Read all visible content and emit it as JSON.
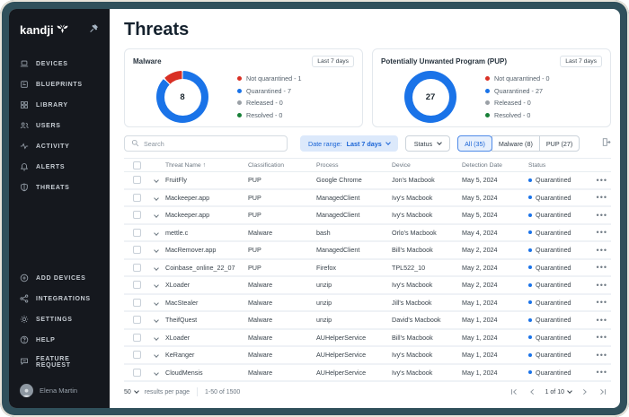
{
  "colors": {
    "accent_blue": "#1a73e8",
    "alert_red": "#d93025",
    "neutral_gray": "#9aa0a6",
    "success_green": "#188038",
    "sidebar_bg": "#15181e",
    "frame_border": "#30505b"
  },
  "sidebar": {
    "logo_text": "kandji",
    "nav": [
      {
        "icon": "devices-icon",
        "label": "DEVICES"
      },
      {
        "icon": "blueprints-icon",
        "label": "BLUEPRINTS"
      },
      {
        "icon": "library-icon",
        "label": "LIBRARY"
      },
      {
        "icon": "users-icon",
        "label": "USERS"
      },
      {
        "icon": "activity-icon",
        "label": "ACTIVITY"
      },
      {
        "icon": "alerts-icon",
        "label": "ALERTS"
      },
      {
        "icon": "threats-icon",
        "label": "THREATS"
      }
    ],
    "secondary_nav": [
      {
        "icon": "add-circle-icon",
        "label": "ADD DEVICES"
      },
      {
        "icon": "integrations-icon",
        "label": "INTEGRATIONS"
      },
      {
        "icon": "settings-icon",
        "label": "SETTINGS"
      },
      {
        "icon": "help-icon",
        "label": "HELP"
      },
      {
        "icon": "feature-request-icon",
        "label": "FEATURE REQUEST"
      }
    ],
    "profile": {
      "name": "Elena Martin"
    }
  },
  "header": {
    "title": "Threats"
  },
  "cards": [
    {
      "title": "Malware",
      "period": "Last 7 days",
      "total": "8",
      "legend": [
        {
          "text": "Not quarantined - 1",
          "color": "#d93025"
        },
        {
          "text": "Quarantined - 7",
          "color": "#1a73e8"
        },
        {
          "text": "Released - 0",
          "color": "#9aa0a6"
        },
        {
          "text": "Resolved - 0",
          "color": "#188038"
        }
      ]
    },
    {
      "title": "Potentially Unwanted Program (PUP)",
      "period": "Last 7 days",
      "total": "27",
      "legend": [
        {
          "text": "Not quarantined - 0",
          "color": "#d93025"
        },
        {
          "text": "Quarantined - 27",
          "color": "#1a73e8"
        },
        {
          "text": "Released - 0",
          "color": "#9aa0a6"
        },
        {
          "text": "Resolved - 0",
          "color": "#188038"
        }
      ]
    }
  ],
  "chart_data": [
    {
      "type": "pie",
      "title": "Malware",
      "period": "Last 7 days",
      "labels": [
        "Quarantined",
        "Not quarantined",
        "Released",
        "Resolved"
      ],
      "values": [
        7,
        1,
        0,
        0
      ],
      "total": 8,
      "colors": [
        "#1a73e8",
        "#d93025",
        "#9aa0a6",
        "#188038"
      ],
      "legend_position": "right"
    },
    {
      "type": "pie",
      "title": "Potentially Unwanted Program (PUP)",
      "period": "Last 7 days",
      "labels": [
        "Quarantined",
        "Not quarantined",
        "Released",
        "Resolved"
      ],
      "values": [
        27,
        0,
        0,
        0
      ],
      "total": 27,
      "colors": [
        "#1a73e8",
        "#d93025",
        "#9aa0a6",
        "#188038"
      ],
      "legend_position": "right"
    }
  ],
  "filters": {
    "search_placeholder": "Search",
    "date_range_prefix": "Date range:",
    "date_range_value": "Last 7 days",
    "status_label": "Status",
    "tabs": {
      "all": "All (35)",
      "malware": "Malware (8)",
      "pup": "PUP (27)"
    }
  },
  "table": {
    "sort_indicator": "↑",
    "columns": [
      "Threat Name",
      "Classification",
      "Process",
      "Device",
      "Detection Date",
      "Status"
    ],
    "rows": [
      {
        "name": "FruitFly",
        "classification": "PUP",
        "process": "Google Chrome",
        "device": "Jon's Macbook",
        "date": "May 5, 2024",
        "status": "Quarantined"
      },
      {
        "name": "Mackeeper.app",
        "classification": "PUP",
        "process": "ManagedClient",
        "device": "Ivy's Macbook",
        "date": "May 5, 2024",
        "status": "Quarantined"
      },
      {
        "name": "Mackeeper.app",
        "classification": "PUP",
        "process": "ManagedClient",
        "device": "Ivy's Macbook",
        "date": "May 5, 2024",
        "status": "Quarantined"
      },
      {
        "name": "mettle.c",
        "classification": "Malware",
        "process": "bash",
        "device": "Orlo's Macbook",
        "date": "May 4, 2024",
        "status": "Quarantined"
      },
      {
        "name": "MacRemover.app",
        "classification": "PUP",
        "process": "ManagedClient",
        "device": "Bill's Macbook",
        "date": "May 2, 2024",
        "status": "Quarantined"
      },
      {
        "name": "Coinbase_online_22_07",
        "classification": "PUP",
        "process": "Firefox",
        "device": "TPL522_10",
        "date": "May 2, 2024",
        "status": "Quarantined"
      },
      {
        "name": "XLoader",
        "classification": "Malware",
        "process": "unzip",
        "device": "Ivy's Macbook",
        "date": "May 2, 2024",
        "status": "Quarantined"
      },
      {
        "name": "MacStealer",
        "classification": "Malware",
        "process": "unzip",
        "device": "Jill's Macbook",
        "date": "May 1, 2024",
        "status": "Quarantined"
      },
      {
        "name": "TheifQuest",
        "classification": "Malware",
        "process": "unzip",
        "device": "David's Macbook",
        "date": "May 1, 2024",
        "status": "Quarantined"
      },
      {
        "name": "XLoader",
        "classification": "Malware",
        "process": "AUHelperService",
        "device": "Bill's Macbook",
        "date": "May 1, 2024",
        "status": "Quarantined"
      },
      {
        "name": "KeRanger",
        "classification": "Malware",
        "process": "AUHelperService",
        "device": "Ivy's Macbook",
        "date": "May 1, 2024",
        "status": "Quarantined"
      },
      {
        "name": "CloudMensis",
        "classification": "Malware",
        "process": "AUHelperService",
        "device": "Ivy's Macbook",
        "date": "May 1, 2024",
        "status": "Quarantined"
      }
    ]
  },
  "footer": {
    "page_size": "50",
    "per_page_label": "results per page",
    "range": "1-50 of 1500",
    "page_indicator": "1 of 10"
  }
}
